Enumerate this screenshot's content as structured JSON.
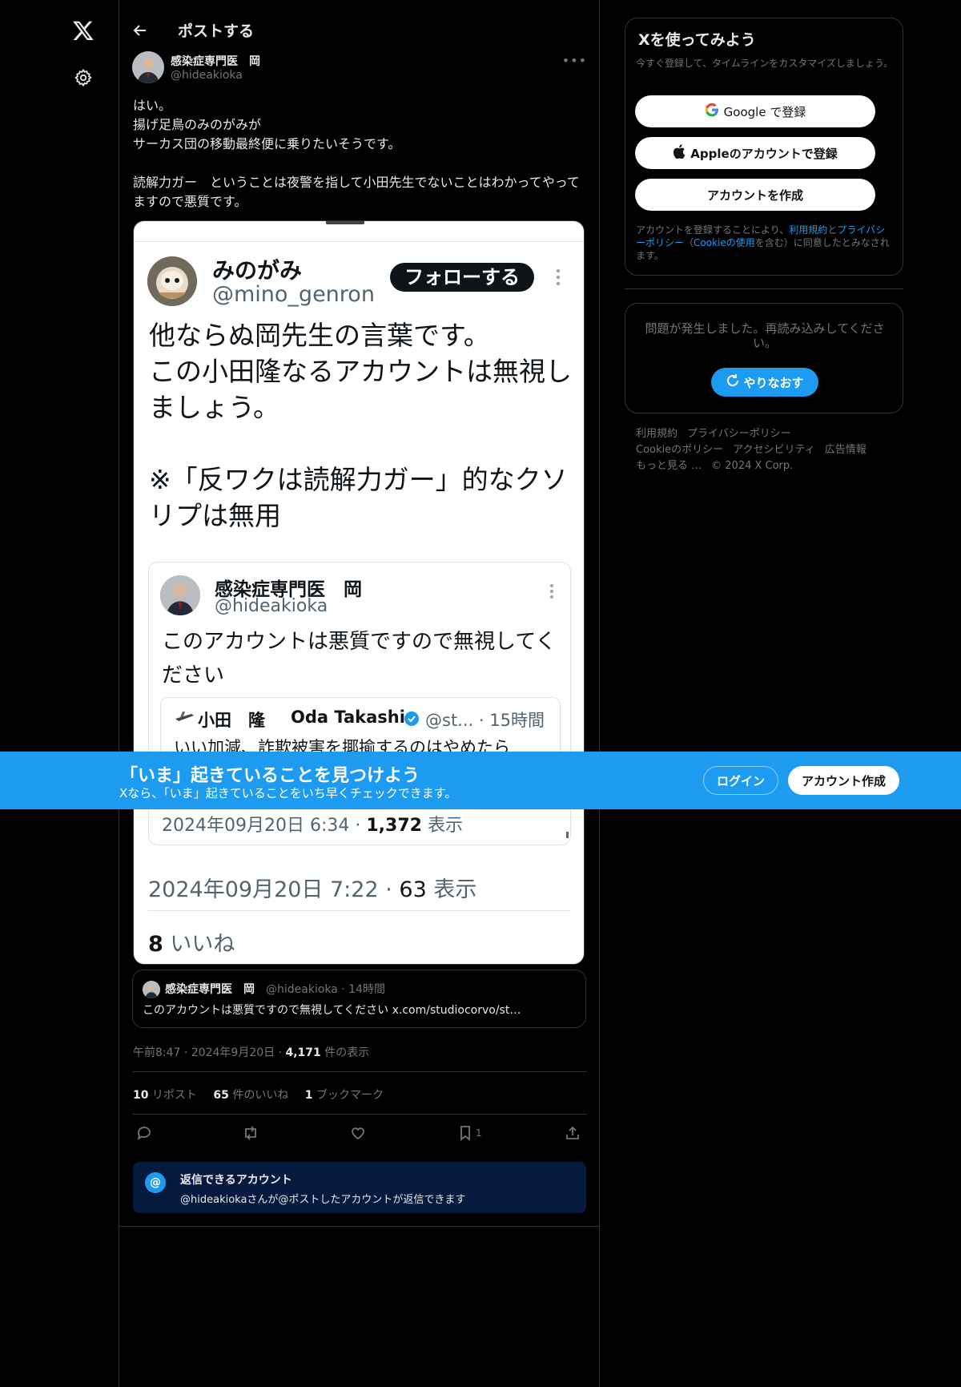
{
  "header": {
    "title": "ポストする"
  },
  "post": {
    "author_name": "感染症専門医　岡",
    "author_handle": "@hideakioka",
    "text": "はい。\n揚げ足鳥のみのがみが\nサーカス団の移動最終便に乗りたいそうです。\n\n読解力ガー　ということは夜警を指して小田先生でないことはわかってやってますので悪質です。",
    "screenshot": {
      "name": "みのがみ",
      "handle": "@mino_genron",
      "follow_label": "フォローする",
      "text": "他ならぬ岡先生の言葉です。\nこの小田隆なるアカウントは無視しましょう。\n\n※「反ワクは読解力ガー」的なクソリプは無用",
      "quote": {
        "name": "感染症専門医　岡",
        "handle": "@hideakioka",
        "text": "このアカウントは悪質ですので無視してください",
        "inner": {
          "name": "小田　隆",
          "name2": "Oda Takashi",
          "handle": "@st... · 15時間",
          "text": "いい加減、詐欺被害を揶揄するのはやめたら"
        },
        "meta_date": "2024年09月20日 6:34 · ",
        "meta_views": "1,372",
        "meta_unit": " 表示"
      },
      "meta_date": "2024年09月20日 7:22 · ",
      "meta_views": "63",
      "meta_unit": " 表示",
      "likes_count": "8",
      "likes_label": " いいね"
    },
    "quoted": {
      "name": "感染症専門医　岡",
      "handle": "@hideakioka · 14時間",
      "text": "このアカウントは悪質ですので無視してください x.com/studiocorvo/st…"
    },
    "timestamp": "午前8:47 · 2024年9月20日 · ",
    "views_count": "4,171",
    "views_label": " 件の表示",
    "stats": {
      "reposts_count": "10",
      "reposts_label": " リポスト",
      "likes_count": "65",
      "likes_label": " 件のいいね",
      "bookmarks_count": "1",
      "bookmarks_label": " ブックマーク"
    },
    "actions": {
      "bookmark_count": "1"
    },
    "reply_restriction": {
      "title": "返信できるアカウント",
      "desc": "@hideakiokaさんが@ポストしたアカウントが返信できます"
    }
  },
  "signup": {
    "title": "Xを使ってみよう",
    "subtitle": "今すぐ登録して、タイムラインをカスタマイズしましょう。",
    "google_label": "Google で登録",
    "apple_label": "Appleのアカウントで登録",
    "create_label": "アカウントを作成",
    "terms_prefix": "アカウントを登録することにより、",
    "terms_link": "利用規約",
    "terms_and": "と",
    "privacy_link": "プライバシーポリシー",
    "terms_paren_open": "（",
    "cookie_link": "Cookieの使用",
    "terms_suffix": "を含む）に同意したとみなされます。"
  },
  "error": {
    "text": "問題が発生しました。再読み込みしてください。",
    "retry_label": "やりなおす"
  },
  "footer": {
    "links": [
      "利用規約",
      "プライバシーポリシー",
      "Cookieのポリシー",
      "アクセシビリティ",
      "広告情報",
      "もっと見る …",
      "© 2024 X Corp."
    ]
  },
  "banner": {
    "title": "「いま」起きていることを見つけよう",
    "subtitle": "Xなら、「いま」起きていることをいち早くチェックできます。",
    "login_label": "ログイン",
    "signup_label": "アカウント作成"
  },
  "colors": {
    "accent": "#1d9bf0",
    "background": "#000000",
    "muted": "#71767b"
  },
  "icons": [
    "x-logo-icon",
    "gear-icon",
    "back-arrow-icon",
    "more-icon",
    "reply-icon",
    "repost-icon",
    "like-icon",
    "bookmark-icon",
    "share-icon",
    "google-icon",
    "apple-icon",
    "refresh-icon",
    "at-icon",
    "verified-icon"
  ]
}
